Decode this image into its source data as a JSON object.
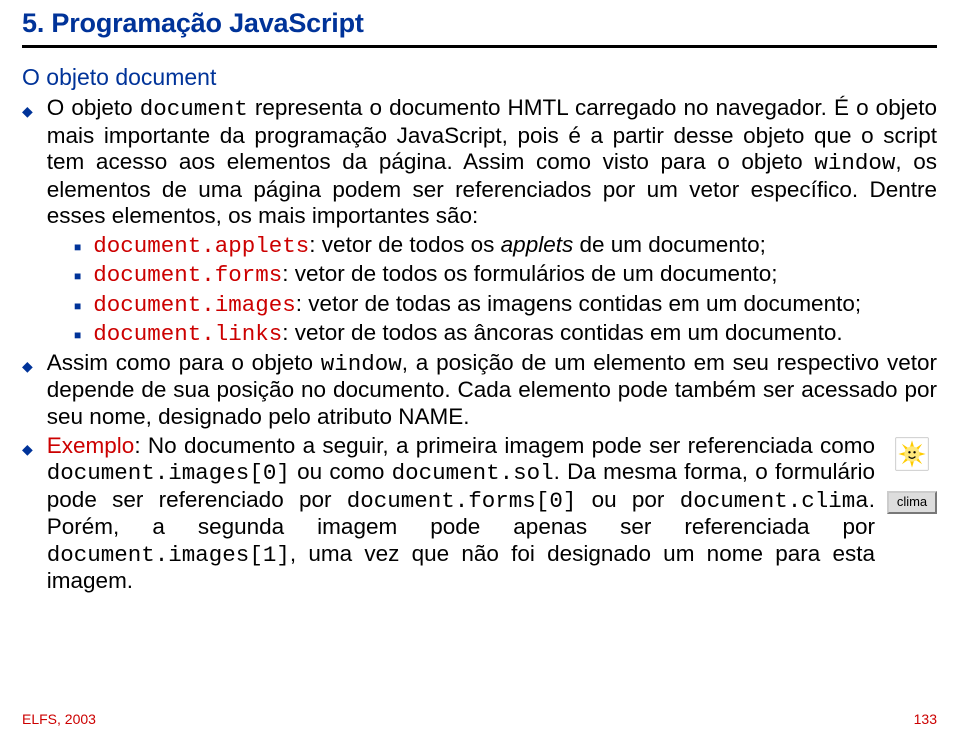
{
  "heading": "5. Programação JavaScript",
  "section_title": "O objeto document",
  "para1_a": "O objeto ",
  "para1_code": "document",
  "para1_b": " representa o documento HMTL carregado no navegador. É o objeto mais importante da programação JavaScript, pois é a partir desse objeto que o script tem acesso aos elementos da página. Assim como visto para o objeto ",
  "para1_code2": "window",
  "para1_c": ", os elementos de uma página podem ser referenciados por um vetor específico. Dentre esses elementos, os mais importantes são:",
  "sub": {
    "applets_code": "document.applets",
    "applets_txt": ": vetor de todos os ",
    "applets_it": "applets",
    "applets_end": " de um documento;",
    "forms_code": "document.forms",
    "forms_txt": ": vetor de todos os formulários de um documento;",
    "images_code": "document.images",
    "images_txt": ": vetor de todas as imagens contidas em um documento;",
    "links_code": "document.links",
    "links_txt": ": vetor de todos as âncoras contidas em um documento."
  },
  "para2_a": "Assim como para o objeto ",
  "para2_code": "window",
  "para2_b": ", a posição de um elemento em seu respectivo vetor depende de sua posição no documento. Cada elemento pode também ser acessado por seu nome, designado pelo atributo NAME.",
  "ex_label": "Exemplo",
  "ex_a": ": No documento a seguir, a primeira imagem pode ser referenciada como ",
  "ex_c1": "document.images[0]",
  "ex_b": " ou como ",
  "ex_c2": "document.sol",
  "ex_c": ". Da mesma forma, o formulário pode ser referenciado por ",
  "ex_c3": "document.forms[0]",
  "ex_d": " ou por ",
  "ex_c4": "document.clima",
  "ex_e": ". Porém, a segunda imagem pode apenas ser referenciada por ",
  "ex_c5": "document.images[1]",
  "ex_f": ", uma vez que não foi designado um nome para esta imagem.",
  "clima_label": "clima",
  "footer_left": "ELFS, 2003",
  "footer_right": "133"
}
